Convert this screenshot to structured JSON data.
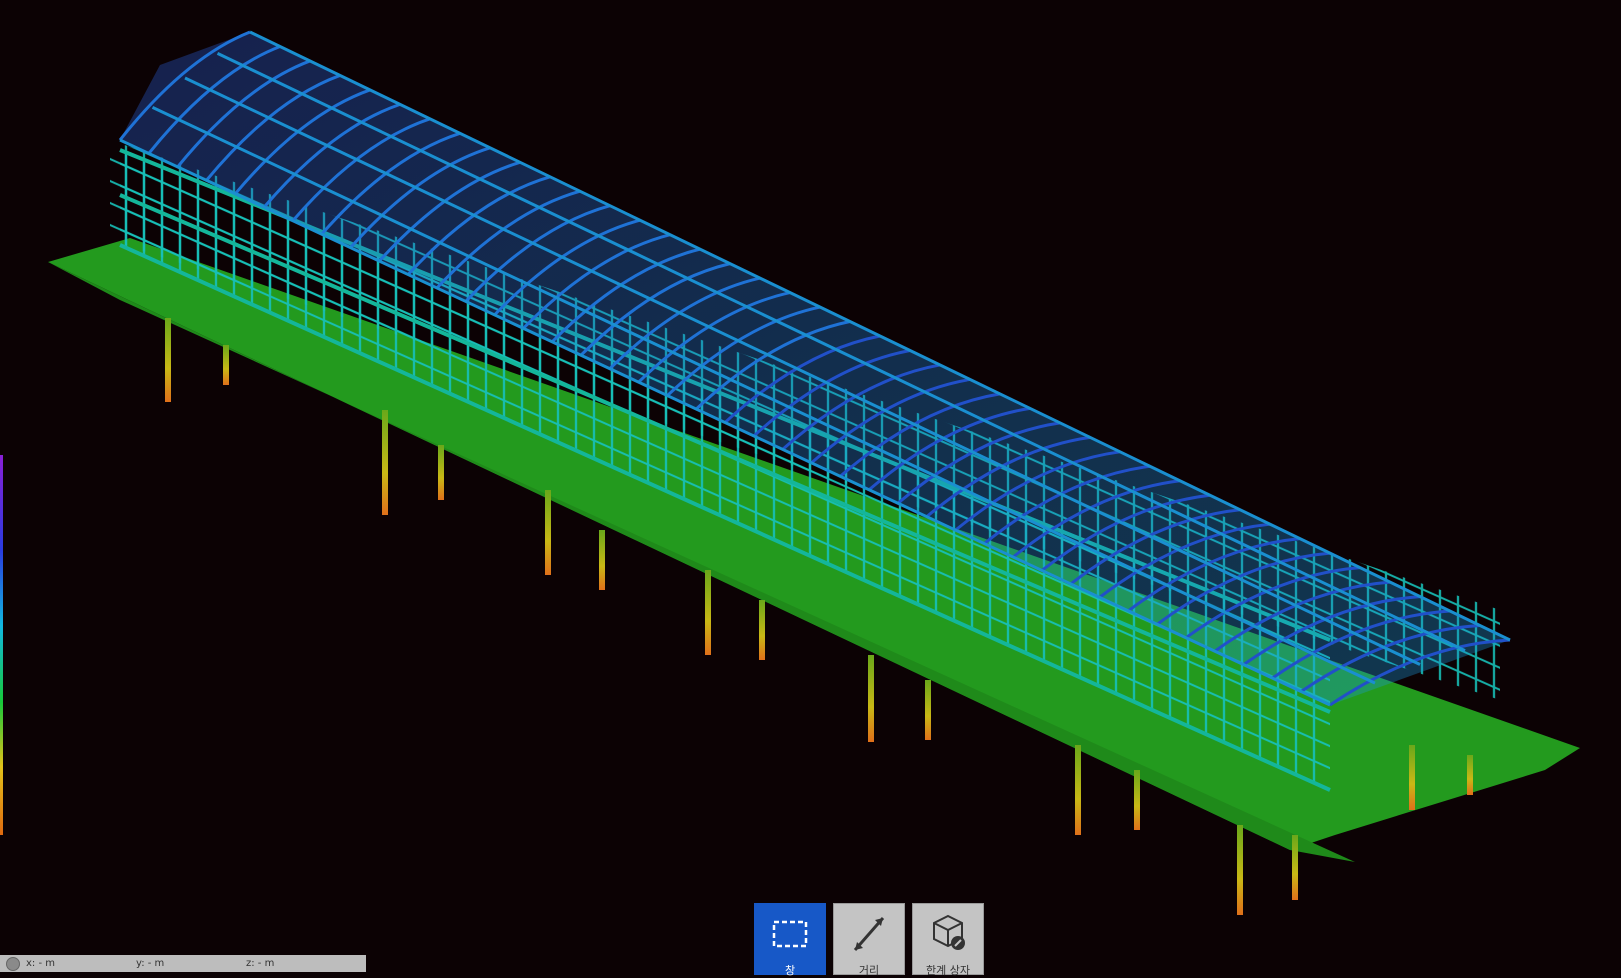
{
  "viewer": {
    "color_scheme": "elevation",
    "legend_colors": [
      "#8a1fd6",
      "#2a3be0",
      "#12b8e0",
      "#17c93a",
      "#e3c21a",
      "#e06a10"
    ]
  },
  "toolbar": {
    "items": [
      {
        "label": "창",
        "icon": "select-window-icon",
        "active": true
      },
      {
        "label": "거리",
        "icon": "measure-distance-icon",
        "active": false
      },
      {
        "label": "한계 상자",
        "icon": "bounding-box-icon",
        "active": false
      }
    ]
  },
  "status": {
    "x": "x: - m",
    "y": "y: - m",
    "z": "z: - m"
  }
}
